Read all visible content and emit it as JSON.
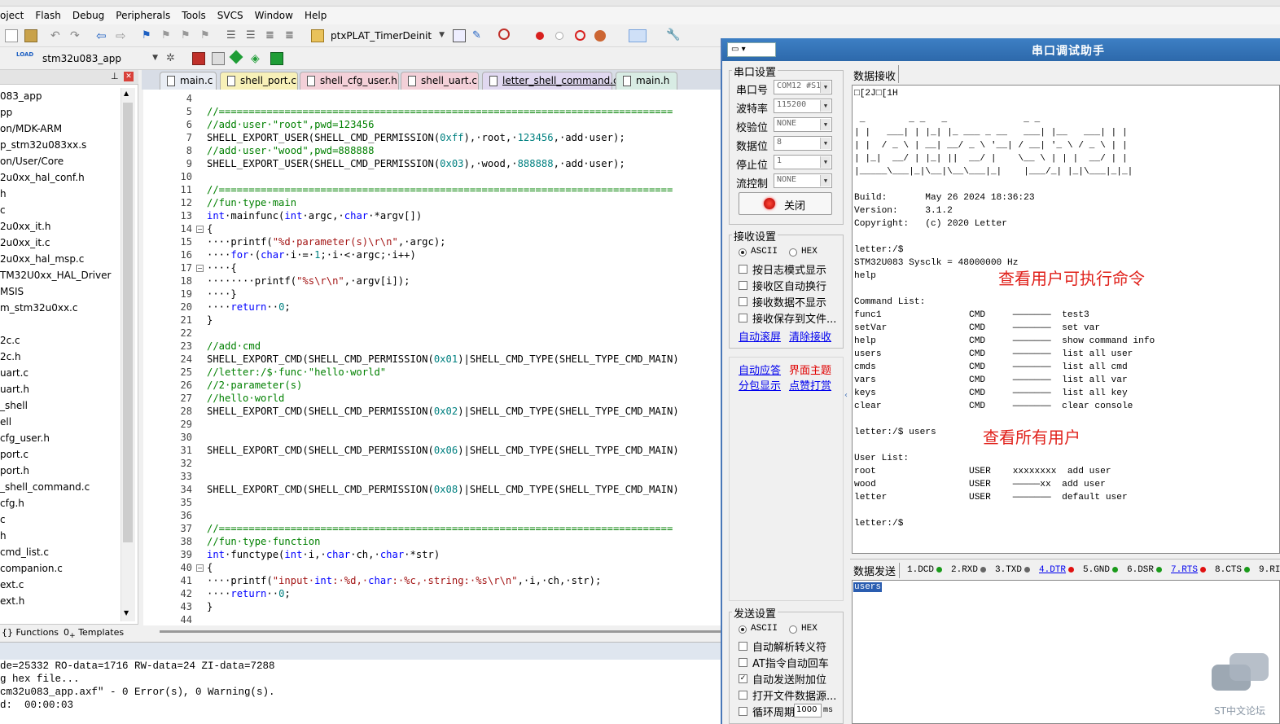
{
  "menu": [
    "oject",
    "Flash",
    "Debug",
    "Peripherals",
    "Tools",
    "SVCS",
    "Window",
    "Help"
  ],
  "toolbar": {
    "function_combo": "ptxPLAT_TimerDeinit",
    "target_combo": "stm32u083_app",
    "load_label": "LOAD"
  },
  "project_tree": {
    "items": [
      "083_app",
      "pp",
      "on/MDK-ARM",
      "p_stm32u083xx.s",
      "on/User/Core",
      "2u0xx_hal_conf.h",
      "h",
      "c",
      "2u0xx_it.h",
      "2u0xx_it.c",
      "2u0xx_hal_msp.c",
      "TM32U0xx_HAL_Driver",
      "MSIS",
      "m_stm32u0xx.c",
      "",
      "2c.c",
      "2c.h",
      "uart.c",
      "uart.h",
      "_shell",
      "ell",
      "cfg_user.h",
      "port.c",
      "port.h",
      "_shell_command.c",
      "cfg.h",
      "c",
      "h",
      "cmd_list.c",
      "companion.c",
      "ext.c",
      "ext.h"
    ],
    "footer_functions": "Functions",
    "footer_templates": "Templates",
    "pin_icon": "pin-icon",
    "close_icon": "close-icon"
  },
  "tabs": [
    {
      "label": "main.c",
      "color": "#e8ecf3"
    },
    {
      "label": "shell_port.c",
      "color": "#f7f0b8"
    },
    {
      "label": "shell_cfg_user.h",
      "color": "#f3d0d8"
    },
    {
      "label": "shell_uart.c",
      "color": "#f3d0d8"
    },
    {
      "label": "letter_shell_command.c",
      "color": "#e0d8f0"
    },
    {
      "label": "main.h",
      "color": "#d8ece4"
    }
  ],
  "code": {
    "line_numbers": [
      "4",
      "5",
      "6",
      "7",
      "8",
      "9",
      "10",
      "11",
      "12",
      "13",
      "14",
      "15",
      "16",
      "17",
      "18",
      "19",
      "20",
      "21",
      "22",
      "23",
      "24",
      "25",
      "26",
      "27",
      "28",
      "29",
      "30",
      "31",
      "32",
      "33",
      "34",
      "35",
      "36",
      "37",
      "38",
      "39",
      "40",
      "41",
      "42",
      "43",
      "44"
    ],
    "lines": [
      "",
      "//============================================================================",
      "//add·user·\"root\",pwd=123456",
      "SHELL_EXPORT_USER(SHELL_CMD_PERMISSION(0xff),·root,·123456,·add·user);",
      "//add·user·\"wood\",pwd=888888",
      "SHELL_EXPORT_USER(SHELL_CMD_PERMISSION(0x03),·wood,·888888,·add·user);",
      "",
      "//============================================================================",
      "//fun·type·main",
      "int·mainfunc(int·argc,·char·*argv[])",
      "{",
      "····printf(\"%d·parameter(s)\\r\\n\",·argc);",
      "····for·(char·i·=·1;·i·<·argc;·i++)",
      "····{",
      "········printf(\"%s\\r\\n\",·argv[i]);",
      "····}",
      "····return··0;",
      "}",
      "",
      "//add·cmd",
      "SHELL_EXPORT_CMD(SHELL_CMD_PERMISSION(0x01)|SHELL_CMD_TYPE(SHELL_TYPE_CMD_MAIN)",
      "//letter:/$·func·\"hello·world\"",
      "//2·parameter(s)",
      "//hello·world",
      "SHELL_EXPORT_CMD(SHELL_CMD_PERMISSION(0x02)|SHELL_CMD_TYPE(SHELL_TYPE_CMD_MAIN)",
      "",
      "",
      "SHELL_EXPORT_CMD(SHELL_CMD_PERMISSION(0x06)|SHELL_CMD_TYPE(SHELL_TYPE_CMD_MAIN)",
      "",
      "",
      "SHELL_EXPORT_CMD(SHELL_CMD_PERMISSION(0x08)|SHELL_CMD_TYPE(SHELL_TYPE_CMD_MAIN)",
      "",
      "",
      "//============================================================================",
      "//fun·type·function",
      "int·functype(int·i,·char·ch,·char·*str)",
      "{",
      "····printf(\"input·int:·%d,·char:·%c,·string:·%s\\r\\n\",·i,·ch,·str);",
      "····return··0;",
      "}",
      ""
    ]
  },
  "build_output": [
    "de=25332 RO-data=1716 RW-data=24 ZI-data=7288",
    "g hex file...",
    "cm32u083_app.axf\" - 0 Error(s), 0 Warning(s).",
    "d:  00:00:03"
  ],
  "serial": {
    "title": "串口调试助手",
    "port_settings": {
      "group": "串口设置",
      "port_label": "串口号",
      "port_value": "COM12 #S1",
      "baud_label": "波特率",
      "baud_value": "115200",
      "parity_label": "校验位",
      "parity_value": "NONE",
      "data_label": "数据位",
      "data_value": "8",
      "stop_label": "停止位",
      "stop_value": "1",
      "flow_label": "流控制",
      "flow_value": "NONE",
      "close_button": "关闭"
    },
    "rx_settings": {
      "group": "接收设置",
      "ascii": "ASCII",
      "hex": "HEX",
      "opt1": "按日志模式显示",
      "opt2": "接收区自动换行",
      "opt3": "接收数据不显示",
      "opt4": "接收保存到文件...",
      "auto_scroll": "自动滚屏",
      "clear_rx": "清除接收"
    },
    "misc": {
      "auto_reply": "自动应答",
      "theme": "界面主题",
      "packet_display": "分包显示",
      "donate": "点赞打赏"
    },
    "tx_settings": {
      "group": "发送设置",
      "ascii": "ASCII",
      "hex": "HEX",
      "opt1": "自动解析转义符",
      "opt2": "AT指令自动回车",
      "opt3": "自动发送附加位",
      "opt4": "打开文件数据源...",
      "opt5": "循环周期",
      "period_value": "1000",
      "period_unit": "ms"
    },
    "rx_tab": "数据接收",
    "tx_tab": "数据发送",
    "signals": [
      {
        "label": "1.DCD",
        "led": "#1a9a1a",
        "link": false
      },
      {
        "label": "2.RXD",
        "led": "#666666",
        "link": false
      },
      {
        "label": "3.TXD",
        "led": "#666666",
        "link": false
      },
      {
        "label": "4.DTR",
        "led": "#e01010",
        "link": true
      },
      {
        "label": "5.GND",
        "led": "#1a9a1a",
        "link": false
      },
      {
        "label": "6.DSR",
        "led": "#1a9a1a",
        "link": false
      },
      {
        "label": "7.RTS",
        "led": "#e01010",
        "link": true
      },
      {
        "label": "8.CTS",
        "led": "#1a9a1a",
        "link": false
      },
      {
        "label": "9.RI",
        "led": "#666666",
        "link": false
      }
    ],
    "rx_lines": [
      "□[2J□[1H",
      "",
      " _        _ _   _              _ _",
      "| |   ___| | |_| |_ ___ _ __   ___| |__   ___| | |",
      "| |  / _ \\ | __| __/ _ \\ '__| / __| '_ \\ / _ \\ | |",
      "| |_|  __/ | |_| ||  __/ |    \\__ \\ | | |  __/ | |",
      "|_____\\___|_|\\__|\\__\\___|_|    |___/_| |_|\\___|_|_|",
      "",
      "Build:       May 26 2024 18:36:23",
      "Version:     3.1.2",
      "Copyright:   (c) 2020 Letter",
      "",
      "letter:/$",
      "STM32U083 Sysclk = 48000000 Hz",
      "help",
      "",
      "Command List:",
      "func1                CMD     ———————  test3",
      "setVar               CMD     ———————  set var",
      "help                 CMD     ———————  show command info",
      "users                CMD     ———————  list all user",
      "cmds                 CMD     ———————  list all cmd",
      "vars                 CMD     ———————  list all var",
      "keys                 CMD     ———————  list all key",
      "clear                CMD     ———————  clear console",
      "",
      "letter:/$ users",
      "",
      "User List:",
      "root                 USER    xxxxxxxx  add user",
      "wood                 USER    —————xx  add user",
      "letter               USER    ———————  default user",
      "",
      "letter:/$"
    ],
    "annotation_1": "查看用户可执行命令",
    "annotation_2": "查看所有用户",
    "tx_text": "users"
  },
  "watermark": "ST中文论坛"
}
